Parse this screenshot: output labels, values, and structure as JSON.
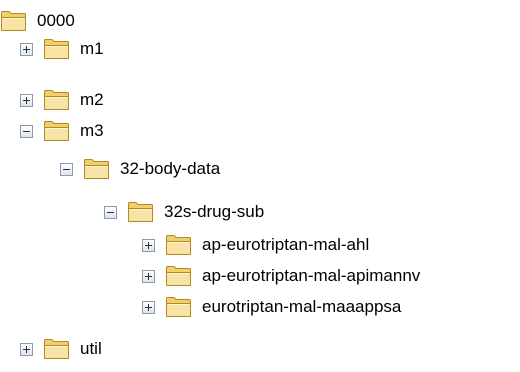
{
  "tree": {
    "nodes": [
      {
        "label": "0000",
        "state": "none",
        "icon": "folder-icon"
      },
      {
        "label": "m1",
        "state": "collapsed",
        "icon": "folder-icon"
      },
      {
        "label": "m2",
        "state": "collapsed",
        "icon": "folder-icon"
      },
      {
        "label": "m3",
        "state": "expanded",
        "icon": "folder-icon"
      },
      {
        "label": "32-body-data",
        "state": "expanded",
        "icon": "folder-icon"
      },
      {
        "label": "32s-drug-sub",
        "state": "expanded",
        "icon": "folder-icon"
      },
      {
        "label": "ap-eurotriptan-mal-ahl",
        "state": "collapsed",
        "icon": "folder-icon"
      },
      {
        "label": "ap-eurotriptan-mal-apimannv",
        "state": "collapsed",
        "icon": "folder-icon"
      },
      {
        "label": "eurotriptan-mal-maaappsa",
        "state": "collapsed",
        "icon": "folder-icon"
      },
      {
        "label": "util",
        "state": "collapsed",
        "icon": "folder-icon"
      }
    ]
  },
  "colors": {
    "folder_fill": "#f3d98c",
    "folder_stroke": "#b38a22",
    "toggle_border": "#8c9ab0"
  }
}
